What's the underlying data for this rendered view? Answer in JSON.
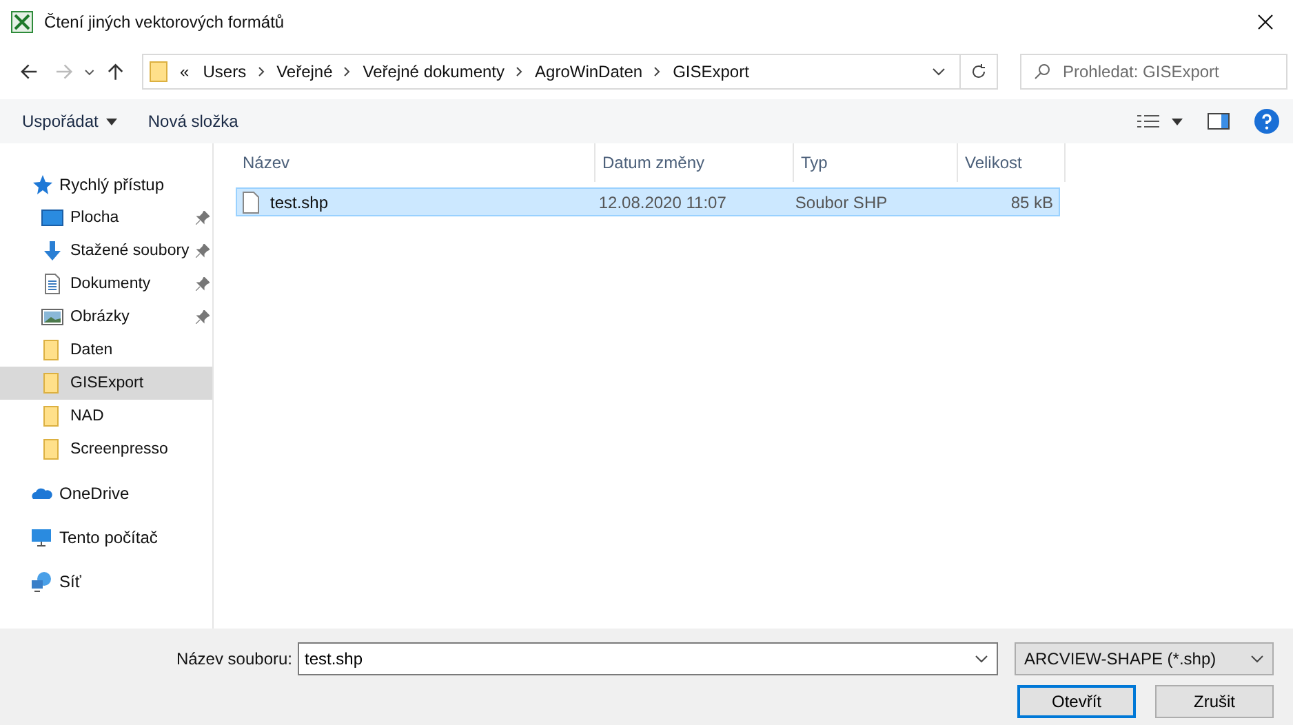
{
  "window": {
    "title": "Čtení jiných vektorových formátů"
  },
  "address": {
    "overflow": "«",
    "path": [
      "Users",
      "Veřejné",
      "Veřejné dokumenty",
      "AgroWinDaten",
      "GISExport"
    ]
  },
  "search": {
    "placeholder": "Prohledat: GISExport"
  },
  "toolbar": {
    "organize": "Uspořádat",
    "new_folder": "Nová složka"
  },
  "sidebar": {
    "items": [
      {
        "label": "Rychlý přístup",
        "kind": "star",
        "selected": false,
        "children": [
          {
            "label": "Plocha",
            "kind": "desktop",
            "pinned": true,
            "selected": false
          },
          {
            "label": "Stažené soubory",
            "kind": "download",
            "pinned": true,
            "selected": false
          },
          {
            "label": "Dokumenty",
            "kind": "document",
            "pinned": true,
            "selected": false
          },
          {
            "label": "Obrázky",
            "kind": "image",
            "pinned": true,
            "selected": false
          },
          {
            "label": "Daten",
            "kind": "folder",
            "pinned": false,
            "selected": false
          },
          {
            "label": "GISExport",
            "kind": "folder",
            "pinned": false,
            "selected": true
          },
          {
            "label": "NAD",
            "kind": "folder",
            "pinned": false,
            "selected": false
          },
          {
            "label": "Screenpresso",
            "kind": "folder",
            "pinned": false,
            "selected": false
          }
        ]
      },
      {
        "label": "OneDrive",
        "kind": "cloud",
        "selected": false
      },
      {
        "label": "Tento počítač",
        "kind": "computer",
        "selected": false
      },
      {
        "label": "Síť",
        "kind": "network",
        "selected": false
      }
    ]
  },
  "table": {
    "columns": [
      "Název",
      "Datum změny",
      "Typ",
      "Velikost"
    ],
    "rows": [
      {
        "cells": [
          "test.shp",
          "12.08.2020 11:07",
          "Soubor SHP",
          "85 kB"
        ],
        "selected": true
      }
    ]
  },
  "footer": {
    "filename_label": "Název souboru:",
    "filename": "test.shp",
    "filter": "ARCVIEW-SHAPE (*.shp)",
    "buttons": [
      "Otevřít",
      "Zrušit"
    ]
  }
}
